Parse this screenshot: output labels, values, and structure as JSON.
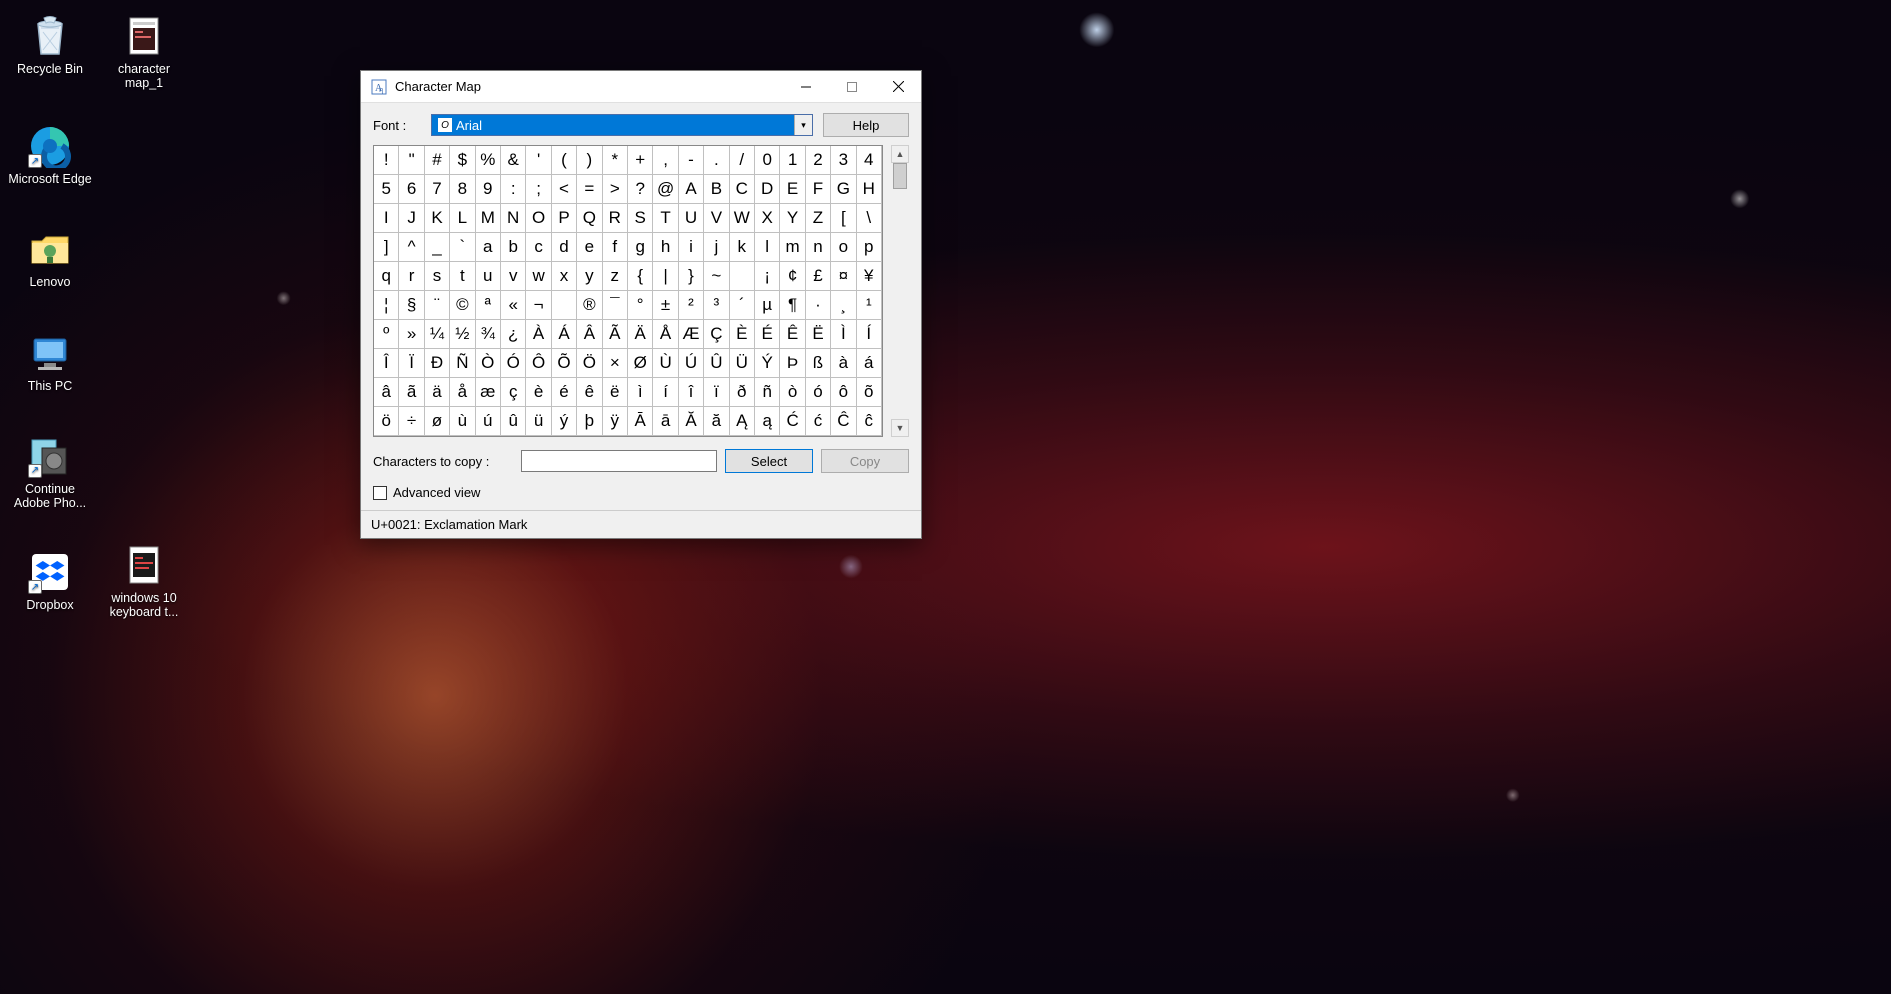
{
  "desktop": {
    "icons_col1": [
      {
        "name": "recycle-bin",
        "label": "Recycle Bin"
      },
      {
        "name": "edge",
        "label": "Microsoft Edge"
      },
      {
        "name": "lenovo",
        "label": "Lenovo"
      },
      {
        "name": "this-pc",
        "label": "This PC"
      },
      {
        "name": "adobe",
        "label": "Continue Adobe Pho..."
      },
      {
        "name": "dropbox",
        "label": "Dropbox"
      }
    ],
    "icons_col2": [
      {
        "name": "charmap-doc",
        "label": "character map_1"
      },
      {
        "name": "kb-doc",
        "label": "windows 10 keyboard t..."
      }
    ]
  },
  "window": {
    "title": "Character Map",
    "font_label": "Font :",
    "font_value": "Arial",
    "help_label": "Help",
    "chars": [
      "!",
      "\"",
      "#",
      "$",
      "%",
      "&",
      "'",
      "(",
      ")",
      "*",
      "+",
      ",",
      "-",
      ".",
      "/",
      "0",
      "1",
      "2",
      "3",
      "4",
      "5",
      "6",
      "7",
      "8",
      "9",
      ":",
      ";",
      "<",
      "=",
      ">",
      "?",
      "@",
      "A",
      "B",
      "C",
      "D",
      "E",
      "F",
      "G",
      "H",
      "I",
      "J",
      "K",
      "L",
      "M",
      "N",
      "O",
      "P",
      "Q",
      "R",
      "S",
      "T",
      "U",
      "V",
      "W",
      "X",
      "Y",
      "Z",
      "[",
      "\\",
      "]",
      "^",
      "_",
      "`",
      "a",
      "b",
      "c",
      "d",
      "e",
      "f",
      "g",
      "h",
      "i",
      "j",
      "k",
      "l",
      "m",
      "n",
      "o",
      "p",
      "q",
      "r",
      "s",
      "t",
      "u",
      "v",
      "w",
      "x",
      "y",
      "z",
      "{",
      "|",
      "}",
      "~",
      "",
      "¡",
      "¢",
      "£",
      "¤",
      "¥",
      "¦",
      "§",
      "¨",
      "©",
      "ª",
      "«",
      "¬",
      "­",
      "®",
      "¯",
      "°",
      "±",
      "²",
      "³",
      "´",
      "µ",
      "¶",
      "·",
      "¸",
      "¹",
      "º",
      "»",
      "¼",
      "½",
      "¾",
      "¿",
      "À",
      "Á",
      "Â",
      "Ã",
      "Ä",
      "Å",
      "Æ",
      "Ç",
      "È",
      "É",
      "Ê",
      "Ë",
      "Ì",
      "Í",
      "Î",
      "Ï",
      "Ð",
      "Ñ",
      "Ò",
      "Ó",
      "Ô",
      "Õ",
      "Ö",
      "×",
      "Ø",
      "Ù",
      "Ú",
      "Û",
      "Ü",
      "Ý",
      "Þ",
      "ß",
      "à",
      "á",
      "â",
      "ã",
      "ä",
      "å",
      "æ",
      "ç",
      "è",
      "é",
      "ê",
      "ë",
      "ì",
      "í",
      "î",
      "ï",
      "ð",
      "ñ",
      "ò",
      "ó",
      "ô",
      "õ",
      "ö",
      "÷",
      "ø",
      "ù",
      "ú",
      "û",
      "ü",
      "ý",
      "þ",
      "ÿ",
      "Ā",
      "ā",
      "Ă",
      "ă",
      "Ą",
      "ą",
      "Ć",
      "ć",
      "Ĉ",
      "ĉ"
    ],
    "copy_label": "Characters to copy :",
    "copy_value": "",
    "select_label": "Select",
    "copy_btn_label": "Copy",
    "advanced_label": "Advanced view",
    "status": "U+0021: Exclamation Mark"
  }
}
